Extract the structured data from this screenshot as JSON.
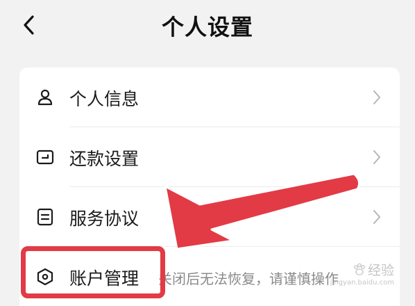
{
  "header": {
    "back_icon": "chevron-left-icon",
    "title": "个人设置"
  },
  "settings": {
    "items": [
      {
        "label": "个人信息",
        "icon": "user-icon"
      },
      {
        "label": "还款设置",
        "icon": "card-icon"
      },
      {
        "label": "服务协议",
        "icon": "document-icon"
      },
      {
        "label": "账户管理",
        "icon": "hexagon-icon",
        "sub": "关闭后无法恢复，请谨慎操作"
      }
    ]
  },
  "annotation": {
    "color": "#e23b45"
  },
  "watermark": {
    "line1": "经验",
    "line2": "jingyan.baidu.com"
  }
}
